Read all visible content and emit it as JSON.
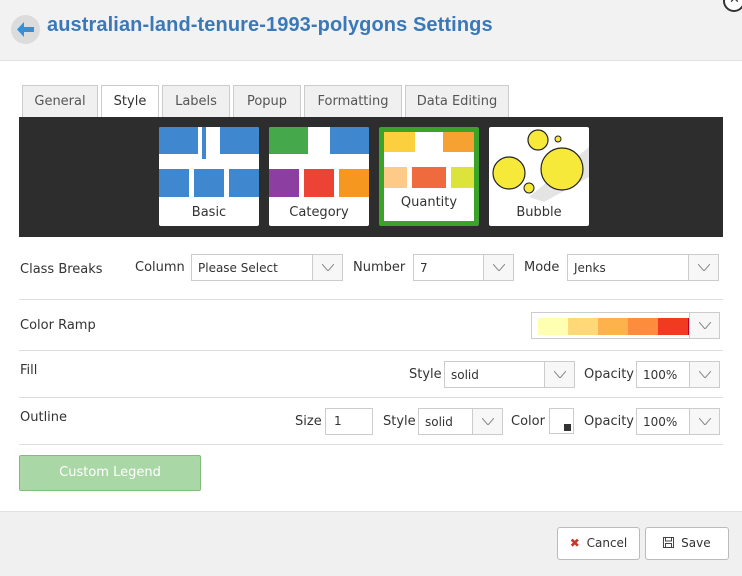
{
  "header": {
    "title": "australian-land-tenure-1993-polygons Settings"
  },
  "tabs": [
    {
      "label": "General"
    },
    {
      "label": "Style"
    },
    {
      "label": "Labels"
    },
    {
      "label": "Popup"
    },
    {
      "label": "Formatting"
    },
    {
      "label": "Data Editing"
    }
  ],
  "active_tab": "Style",
  "style_types": [
    {
      "label": "Basic"
    },
    {
      "label": "Category"
    },
    {
      "label": "Quantity"
    },
    {
      "label": "Bubble"
    }
  ],
  "selected_style": "Quantity",
  "class_breaks": {
    "label": "Class Breaks",
    "column_label": "Column",
    "column_value": "Please Select",
    "number_label": "Number",
    "number_value": "7",
    "mode_label": "Mode",
    "mode_value": "Jenks"
  },
  "color_ramp": {
    "label": "Color Ramp",
    "colors": [
      "#ffffb2",
      "#fed976",
      "#feb24c",
      "#fd8d3c",
      "#f03b20",
      "#bd0026"
    ]
  },
  "fill": {
    "label": "Fill",
    "style_label": "Style",
    "style_value": "solid",
    "opacity_label": "Opacity",
    "opacity_value": "100%"
  },
  "outline": {
    "label": "Outline",
    "size_label": "Size",
    "size_value": "1",
    "style_label": "Style",
    "style_value": "solid",
    "color_label": "Color",
    "color_value": "#ffffff",
    "opacity_label": "Opacity",
    "opacity_value": "100%"
  },
  "custom_legend_label": "Custom Legend",
  "footer": {
    "cancel_label": "Cancel",
    "save_label": "Save"
  },
  "colors": {
    "accent": "#3a78b8",
    "selected": "#39a427",
    "cancel_icon": "#c0392b"
  }
}
